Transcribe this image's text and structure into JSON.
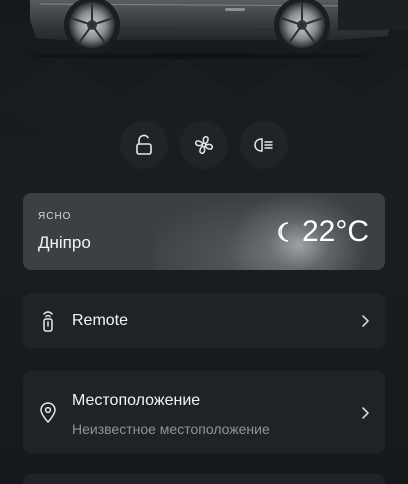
{
  "vehicle": {
    "image_name": "car-side-view"
  },
  "quick_actions": [
    {
      "name": "door-lock",
      "icon": "lock-icon"
    },
    {
      "name": "climate-fan",
      "icon": "fan-icon"
    },
    {
      "name": "headlights",
      "icon": "headlight-icon"
    }
  ],
  "weather": {
    "condition": "ясно",
    "city": "Дніпро",
    "temperature": "22°C",
    "icon": "moon-icon"
  },
  "remote": {
    "label": "Remote",
    "icon": "key-fob-icon"
  },
  "location": {
    "label": "Местоположение",
    "status": "Неизвестное местоположение",
    "icon": "location-pin-icon"
  },
  "colors": {
    "background": "#15181b",
    "card": "#1f2326",
    "weather_card": "#3b4044",
    "subtext": "#8f9498"
  }
}
